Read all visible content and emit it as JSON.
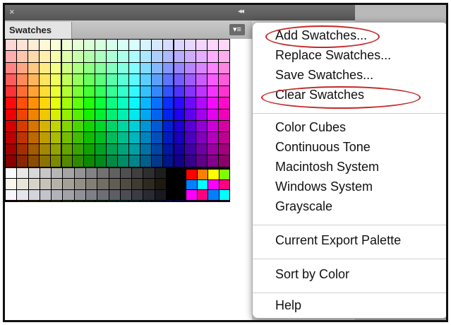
{
  "panel": {
    "close_glyph": "×",
    "collapse_glyph": "◂◂",
    "tab_label": "Swatches",
    "menu_button_glyph": "▾≡"
  },
  "menu": {
    "items": [
      "Add Swatches...",
      "Replace Swatches...",
      "Save Swatches...",
      "Clear Swatches",
      "Color Cubes",
      "Continuous Tone",
      "Macintosh System",
      "Windows System",
      "Grayscale",
      "Current Export Palette",
      "Sort by Color",
      "Help"
    ],
    "highlighted": [
      "Add Swatches...",
      "Clear Swatches"
    ]
  },
  "colors": {
    "annotation_red": "#c62828",
    "panel_title_bg": "#5f5f5f",
    "bright_swatches": [
      "#ff0000",
      "#ff8000",
      "#ffff00",
      "#80ff00",
      "#0080ff",
      "#00ffff",
      "#ff00ff",
      "#ff0080"
    ]
  }
}
